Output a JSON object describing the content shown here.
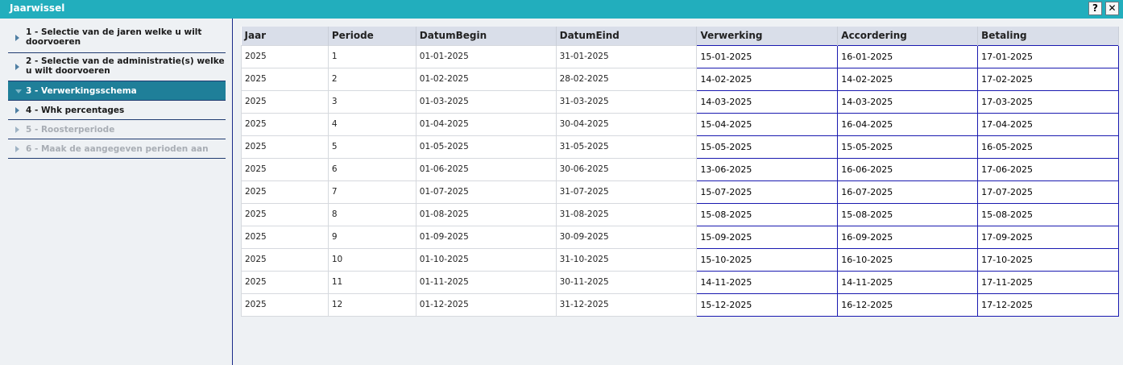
{
  "window": {
    "title": "Jaarwissel",
    "help_label": "?",
    "close_label": "✕"
  },
  "steps": [
    {
      "label": "1 - Selectie van de jaren welke u wilt doorvoeren",
      "state": "normal"
    },
    {
      "label": "2 - Selectie van de administratie(s) welke u wilt doorvoeren",
      "state": "normal"
    },
    {
      "label": "3 - Verwerkingsschema",
      "state": "active"
    },
    {
      "label": "4 - Whk percentages",
      "state": "normal"
    },
    {
      "label": "5 - Roosterperiode",
      "state": "disabled"
    },
    {
      "label": "6 - Maak de aangegeven perioden aan",
      "state": "disabled"
    }
  ],
  "table": {
    "columns": [
      "Jaar",
      "Periode",
      "DatumBegin",
      "DatumEind",
      "Verwerking",
      "Accordering",
      "Betaling"
    ],
    "rows": [
      [
        "2025",
        "1",
        "01-01-2025",
        "31-01-2025",
        "15-01-2025",
        "16-01-2025",
        "17-01-2025"
      ],
      [
        "2025",
        "2",
        "01-02-2025",
        "28-02-2025",
        "14-02-2025",
        "14-02-2025",
        "17-02-2025"
      ],
      [
        "2025",
        "3",
        "01-03-2025",
        "31-03-2025",
        "14-03-2025",
        "14-03-2025",
        "17-03-2025"
      ],
      [
        "2025",
        "4",
        "01-04-2025",
        "30-04-2025",
        "15-04-2025",
        "16-04-2025",
        "17-04-2025"
      ],
      [
        "2025",
        "5",
        "01-05-2025",
        "31-05-2025",
        "15-05-2025",
        "15-05-2025",
        "16-05-2025"
      ],
      [
        "2025",
        "6",
        "01-06-2025",
        "30-06-2025",
        "13-06-2025",
        "16-06-2025",
        "17-06-2025"
      ],
      [
        "2025",
        "7",
        "01-07-2025",
        "31-07-2025",
        "15-07-2025",
        "16-07-2025",
        "17-07-2025"
      ],
      [
        "2025",
        "8",
        "01-08-2025",
        "31-08-2025",
        "15-08-2025",
        "15-08-2025",
        "15-08-2025"
      ],
      [
        "2025",
        "9",
        "01-09-2025",
        "30-09-2025",
        "15-09-2025",
        "16-09-2025",
        "17-09-2025"
      ],
      [
        "2025",
        "10",
        "01-10-2025",
        "31-10-2025",
        "15-10-2025",
        "16-10-2025",
        "17-10-2025"
      ],
      [
        "2025",
        "11",
        "01-11-2025",
        "30-11-2025",
        "14-11-2025",
        "14-11-2025",
        "17-11-2025"
      ],
      [
        "2025",
        "12",
        "01-12-2025",
        "31-12-2025",
        "15-12-2025",
        "16-12-2025",
        "17-12-2025"
      ]
    ]
  },
  "colors": {
    "titlebar": "#22aebd",
    "active_step": "#1f7f99",
    "editable_border": "#1a1ab0",
    "header_bg": "#d9dee9"
  }
}
